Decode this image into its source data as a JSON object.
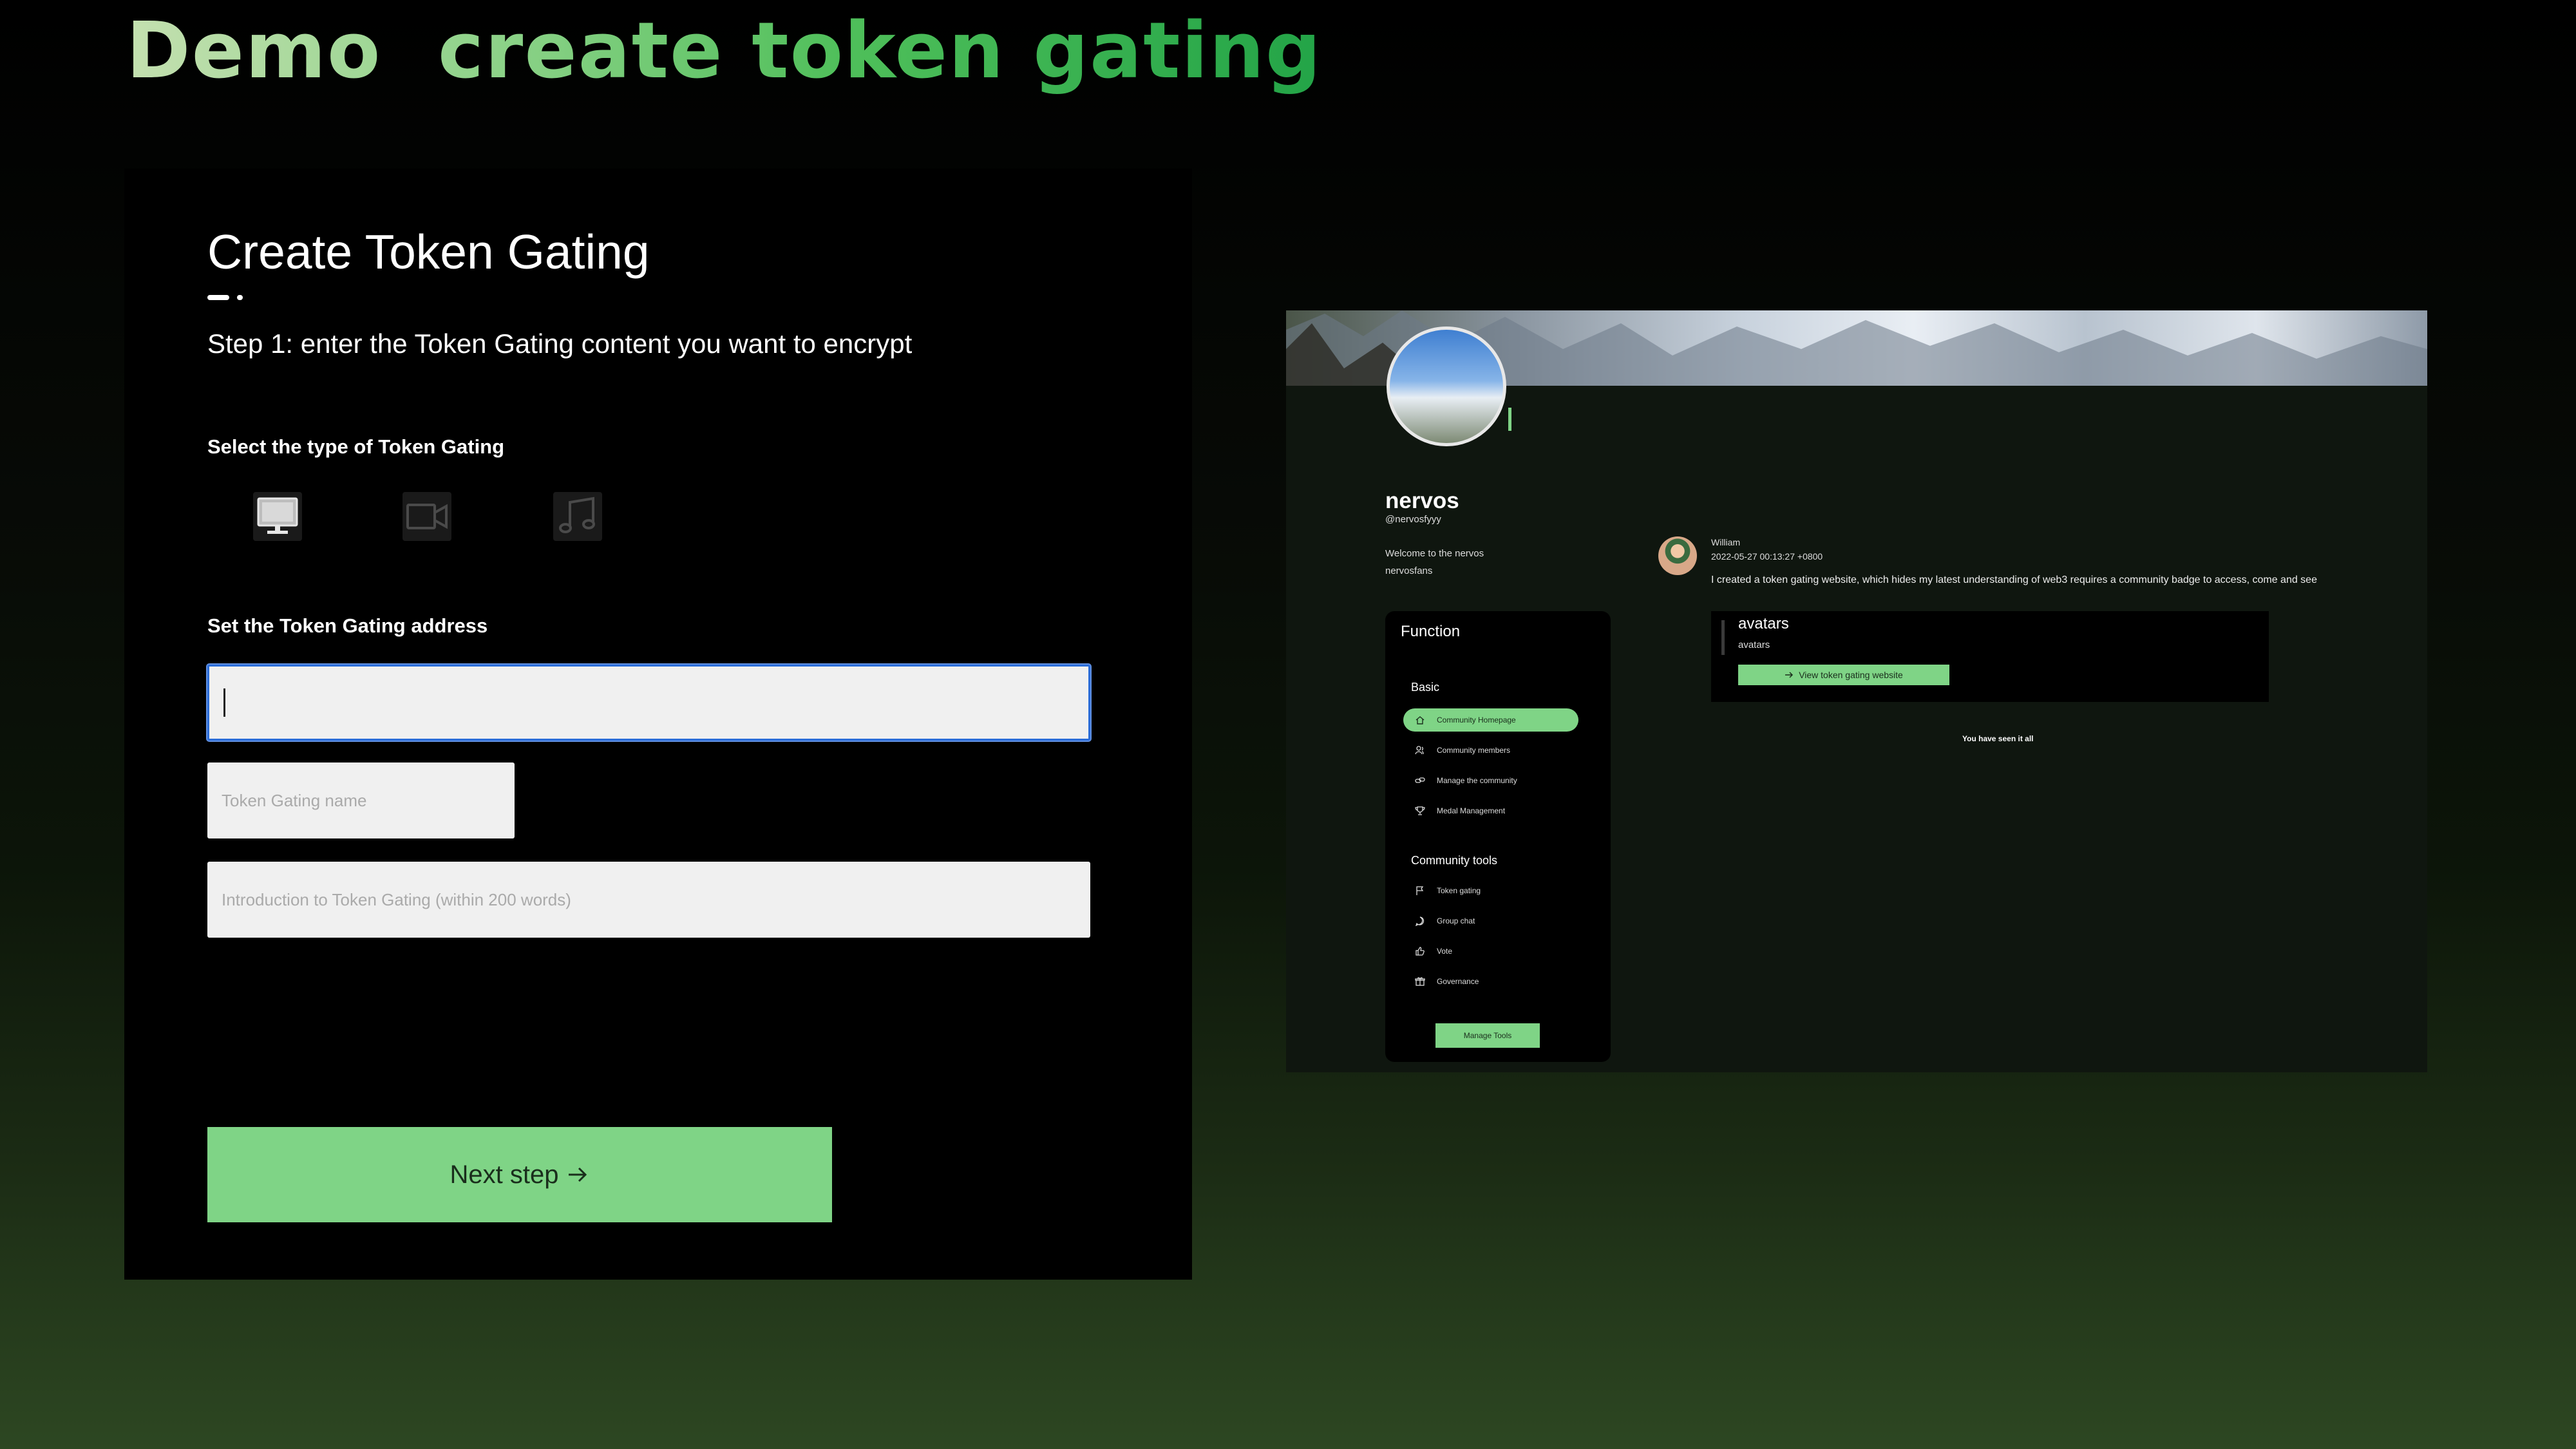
{
  "slide": {
    "title": "Demo  create token gating"
  },
  "form": {
    "title": "Create Token Gating",
    "step_text": "Step 1: enter the Token Gating content you want to encrypt",
    "type_label": "Select the type of Token Gating",
    "type_options": [
      {
        "icon": "monitor-icon"
      },
      {
        "icon": "video-icon"
      },
      {
        "icon": "music-icon"
      }
    ],
    "address_label": "Set the Token Gating address",
    "address_value": "",
    "name_placeholder": "Token Gating name",
    "intro_placeholder": "Introduction to Token Gating  (within 200 words)",
    "next_label": "Next step",
    "next_icon": "arrow-right-icon",
    "accent_color": "#7fd486"
  },
  "preview": {
    "profile": {
      "name": "nervos",
      "handle": "@nervosfyyy",
      "welcome": "Welcome to the nervos",
      "fans": "nervosfans"
    },
    "sidebar": {
      "title": "Function",
      "basic_label": "Basic",
      "basic_items": [
        {
          "label": "Community Homepage",
          "icon": "home-icon",
          "active": true
        },
        {
          "label": "Community members",
          "icon": "members-icon",
          "active": false
        },
        {
          "label": "Manage the community",
          "icon": "link-icon",
          "active": false
        },
        {
          "label": "Medal Management",
          "icon": "trophy-icon",
          "active": false
        }
      ],
      "tools_label": "Community tools",
      "tools_items": [
        {
          "label": "Token gating",
          "icon": "flag-icon"
        },
        {
          "label": "Group chat",
          "icon": "chat-icon"
        },
        {
          "label": "Vote",
          "icon": "thumbs-up-icon"
        },
        {
          "label": "Governance",
          "icon": "gift-icon"
        }
      ],
      "manage_tools_label": "Manage Tools"
    },
    "post": {
      "author": "William",
      "timestamp": "2022-05-27 00:13:27 +0800",
      "text": "I created a token gating website, which hides my latest understanding of web3 requires a community badge to access, come and see",
      "card_title": "avatars",
      "card_subtitle": "avatars",
      "button_label": "View token gating website"
    },
    "end_text": "You have seen it all"
  }
}
